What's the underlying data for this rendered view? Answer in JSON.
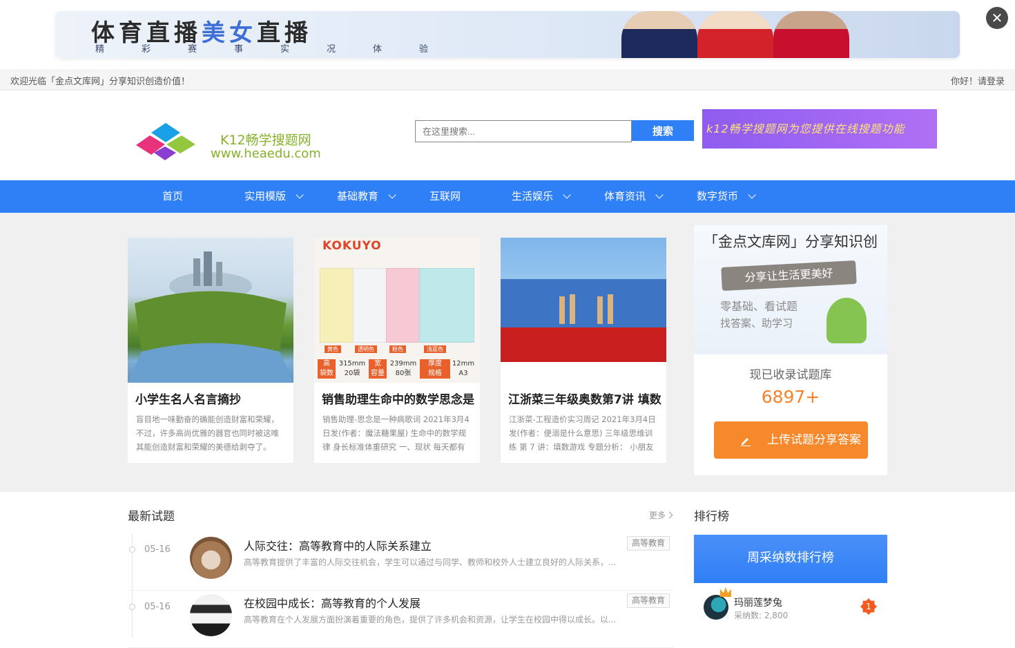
{
  "top_ad": {
    "title_part1": "体育直播",
    "title_part2": "美女",
    "title_part3": "直播",
    "subtitle": "精彩赛事实况体验",
    "close_label": "✕"
  },
  "welcome_bar": {
    "left_text": "欢迎光临「金点文库网」分享知识创造价值！",
    "right_text": "你好！请登录"
  },
  "header": {
    "logo_line1": "K12畅学搜题网",
    "logo_line2": "www.heaedu.com",
    "search_placeholder": "在这里搜索...",
    "search_button": "搜索",
    "ad_text": "k12畅学搜题网为您提供在线搜题功能"
  },
  "nav": {
    "items": [
      {
        "label": "首页",
        "has_dropdown": false
      },
      {
        "label": "实用模版",
        "has_dropdown": true
      },
      {
        "label": "基础教育",
        "has_dropdown": true
      },
      {
        "label": "互联网",
        "has_dropdown": false
      },
      {
        "label": "生活娱乐",
        "has_dropdown": true
      },
      {
        "label": "体育资讯",
        "has_dropdown": true
      },
      {
        "label": "数字货币",
        "has_dropdown": true
      }
    ]
  },
  "featured": [
    {
      "title": "小学生名人名言摘抄",
      "desc": "盲目地一味勤奋的确能创造财富和荣耀，不过，许多高尚优雅的器官也同时被这唯其能创造财富和荣耀的美德给剥夺了。"
    },
    {
      "title": "销售助理生命中的数学思念是",
      "desc": "销售助理-思念是一种病歌词 2021年3月4日发(作者：魔法糖果屋) 生命中的数学规律 身长标准体重研究 一、现状 每天都有"
    },
    {
      "title": "江浙菜三年级奥数第7讲 填数",
      "desc": "江浙菜-工程造价实习周记 2021年3月4日发(作者：便溺是什么意思) 三年级思维训练 第 7 讲：填数游戏 专题分析： 小朋友"
    }
  ],
  "kokuyo_image": {
    "brand": "KOKUYO",
    "colors": [
      "黄色",
      "透明色",
      "粉色",
      "浅蓝色"
    ],
    "spec_row1": [
      "高",
      "315mm",
      "宽",
      "239mm",
      "厚度",
      "12mm"
    ],
    "spec_row2": [
      "袋数",
      "20袋",
      "容量",
      "80张",
      "规格",
      "A3"
    ]
  },
  "side_box": {
    "title": "「金点文库网」分享知识创",
    "ribbon": "分享让生活更美好",
    "slogan1": "零基础、看试题",
    "slogan2": "找答案、助学习",
    "count_label": "现已收录试题库",
    "count_value": "6897+",
    "upload_button": "上传试题分享答案"
  },
  "latest": {
    "title": "最新试题",
    "more_label": "更多",
    "items": [
      {
        "date": "05-16",
        "title": "人际交往：高等教育中的人际关系建立",
        "desc": "高等教育提供了丰富的人际交往机会，学生可以通过与同学、教师和校外人士建立良好的人际关系，...",
        "tag": "高等教育"
      },
      {
        "date": "05-16",
        "title": "在校园中成长：高等教育的个人发展",
        "desc": "高等教育在个人发展方面扮演着重要的角色，提供了许多机会和资源，让学生在校园中得以成长。以...",
        "tag": "高等教育"
      }
    ]
  },
  "ranking": {
    "title": "排行榜",
    "head": "周采纳数排行榜",
    "rows": [
      {
        "name": "玛丽莲梦兔",
        "sub": "采纳数: 2,800",
        "rank": "1"
      }
    ]
  }
}
